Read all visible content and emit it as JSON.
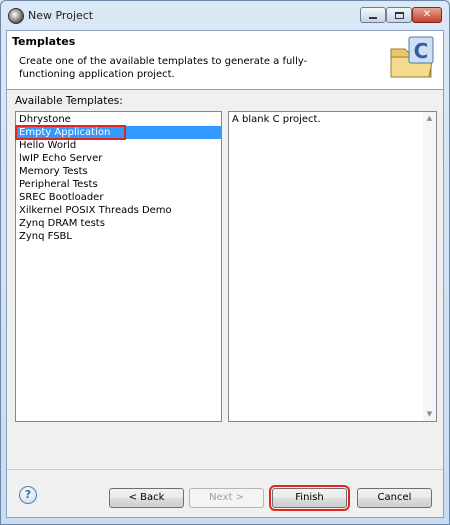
{
  "window": {
    "title": "New Project"
  },
  "header": {
    "title": "Templates",
    "description": "Create one of the available templates to generate a fully-functioning application project."
  },
  "templates": {
    "label": "Available Templates:",
    "items": [
      "Dhrystone",
      "Empty Application",
      "Hello World",
      "lwIP Echo Server",
      "Memory Tests",
      "Peripheral Tests",
      "SREC Bootloader",
      "Xilkernel POSIX Threads Demo",
      "Zynq DRAM tests",
      "Zynq FSBL"
    ],
    "selected_index": 1
  },
  "description_panel": {
    "text": "A blank C project."
  },
  "buttons": {
    "help": "?",
    "back": "< Back",
    "next": "Next >",
    "finish": "Finish",
    "cancel": "Cancel"
  },
  "colors": {
    "selection": "#3399ff",
    "highlight_outline": "#e0261e"
  },
  "icons": {
    "banner": "c-project-folder-icon"
  }
}
